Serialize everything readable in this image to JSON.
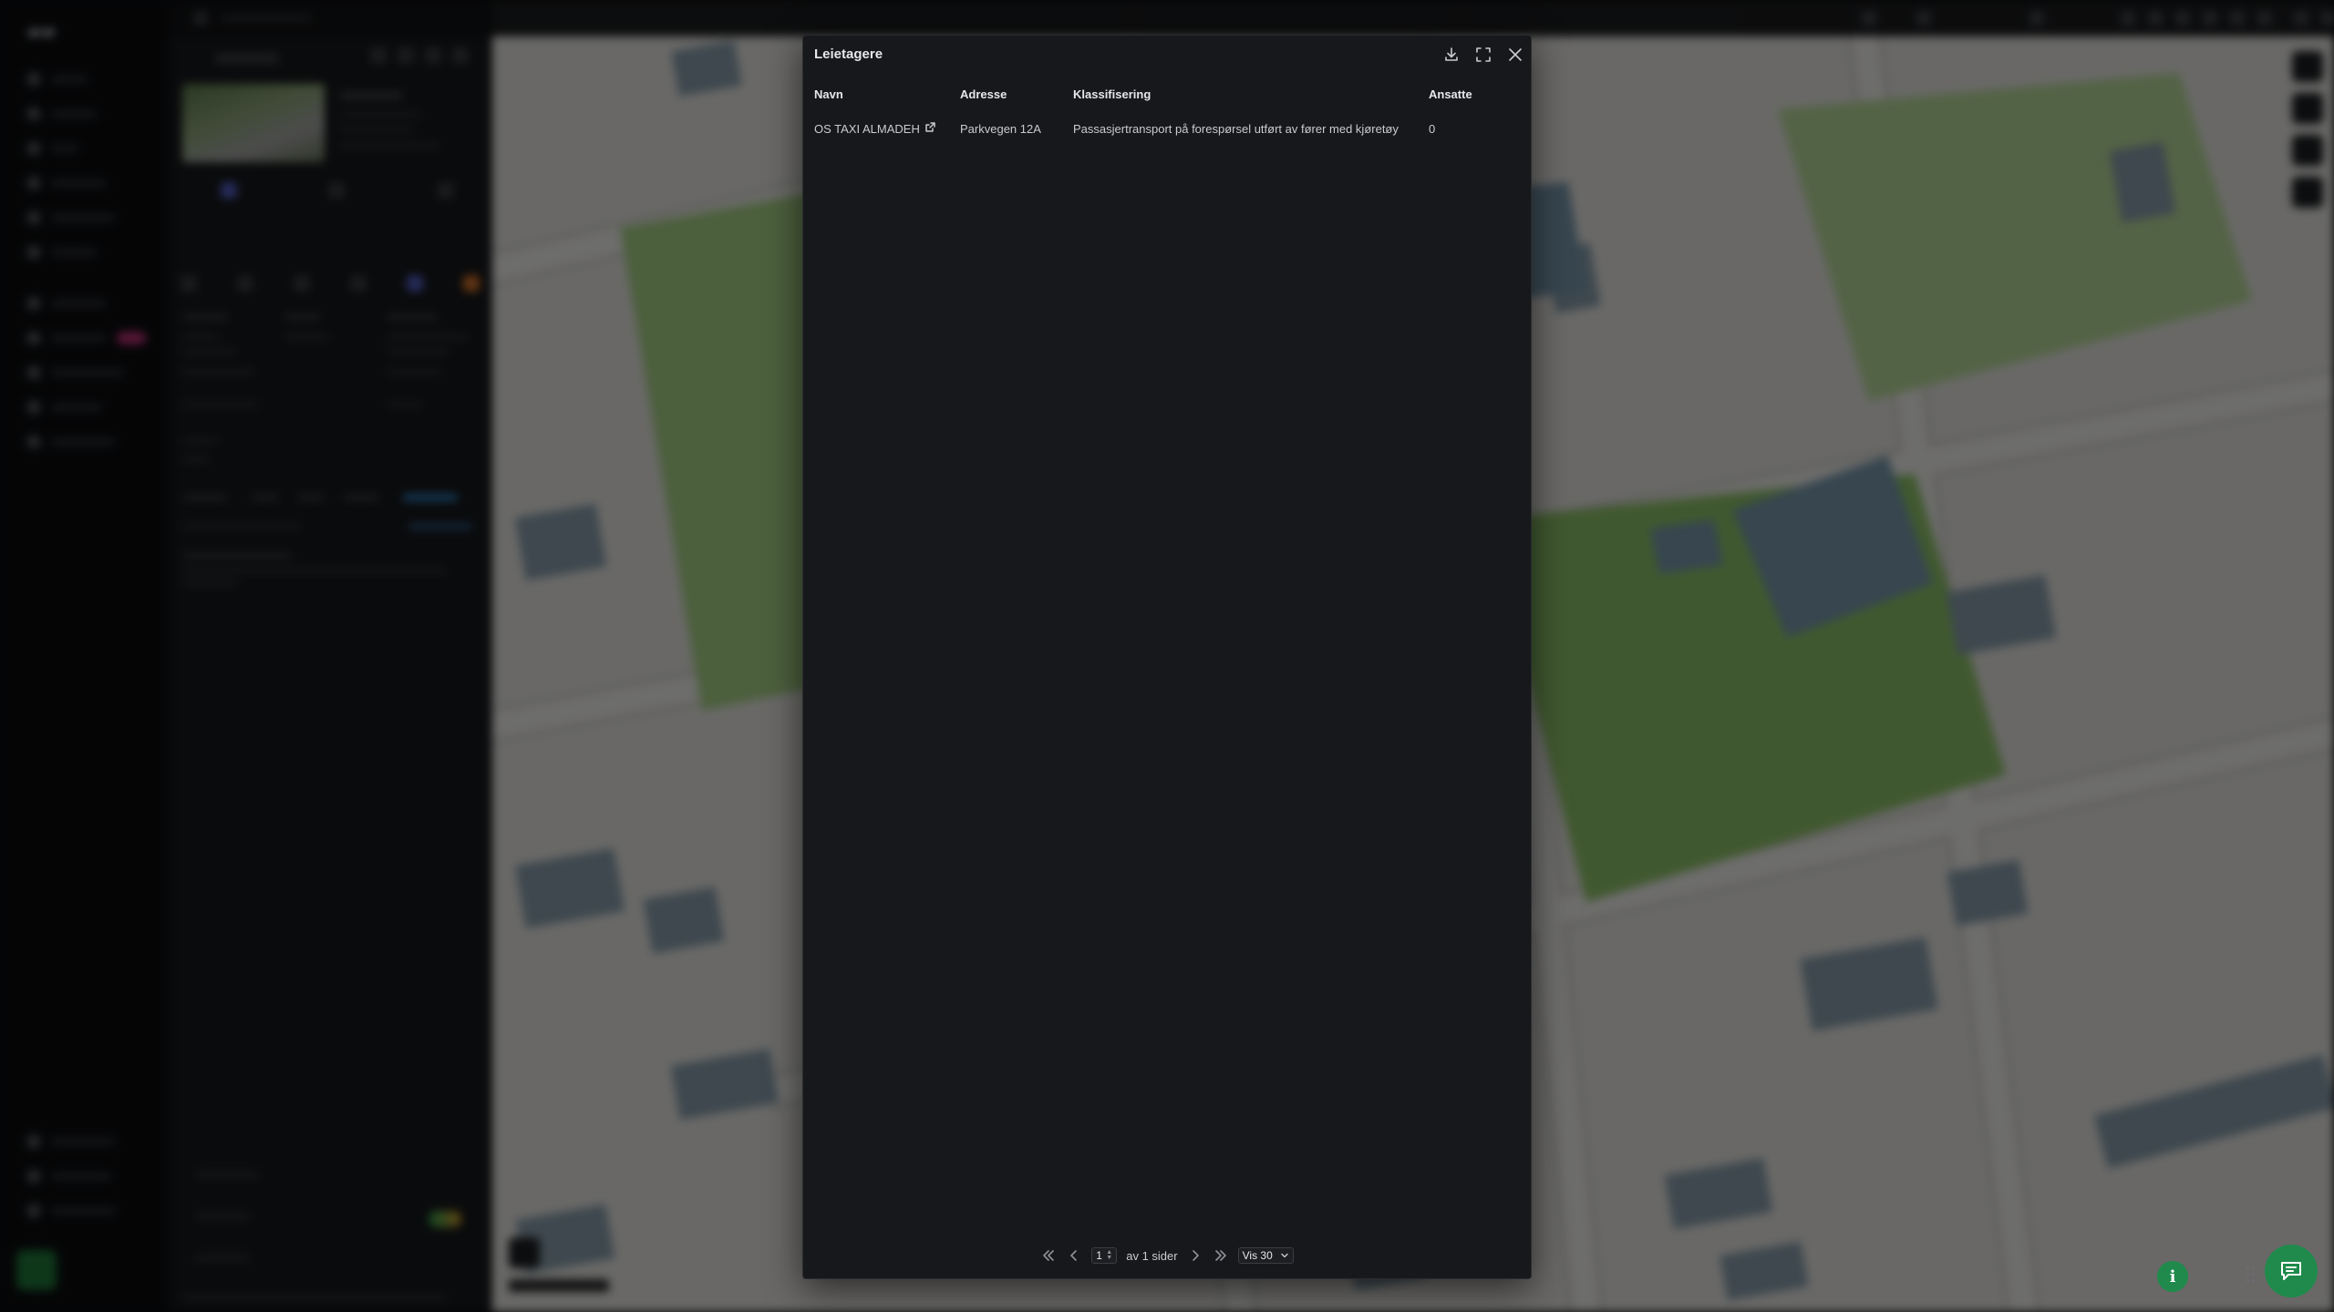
{
  "modal": {
    "title": "Leietagere",
    "columns": [
      "Navn",
      "Adresse",
      "Klassifisering",
      "Ansatte"
    ],
    "rows": [
      {
        "navn": "OS TAXI ALMADEH",
        "adresse": "Parkvegen 12A",
        "klassifisering": "Passasjertransport på forespørsel utført av fører med kjøretøy",
        "ansatte": "0"
      }
    ],
    "pagination": {
      "page": "1",
      "of_text": "av 1 sider",
      "per_page": "Vis 30"
    },
    "icons": {
      "download": "download-icon",
      "fullscreen": "fullscreen-icon",
      "close": "close-icon",
      "external_link": "external-link-icon"
    }
  },
  "floating": {
    "info_label": "i"
  },
  "colors": {
    "modal_bg": "#17181b",
    "overlay": "rgba(0,0,0,0.55)",
    "accent_green": "#1f8a4c",
    "map_park": "#8fc46a",
    "map_building": "#7a9bb0"
  }
}
